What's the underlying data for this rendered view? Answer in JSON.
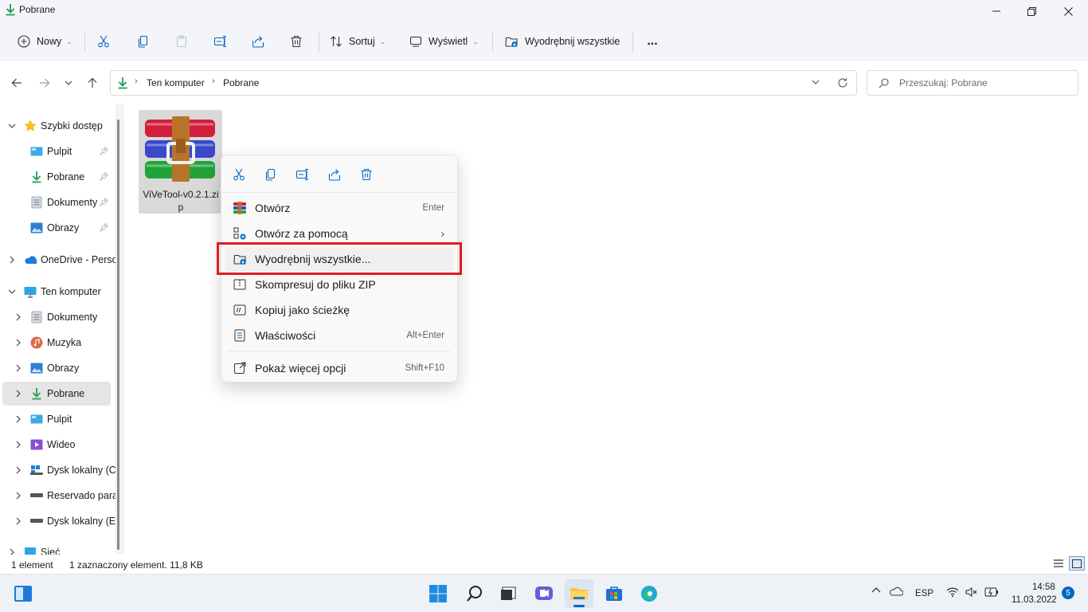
{
  "window": {
    "title": "Pobrane"
  },
  "toolbar": {
    "new_label": "Nowy",
    "sort_label": "Sortuj",
    "view_label": "Wyświetl",
    "extract_label": "Wyodrębnij wszystkie",
    "more_label": "..."
  },
  "address": {
    "crumbs": [
      "Ten komputer",
      "Pobrane"
    ],
    "search_placeholder": "Przeszukaj: Pobrane"
  },
  "sidebar": {
    "quick_access": "Szybki dostęp",
    "quick_items": [
      "Pulpit",
      "Pobrane",
      "Dokumenty",
      "Obrazy"
    ],
    "onedrive": "OneDrive - Perso",
    "this_pc": "Ten komputer",
    "pc_items": [
      "Dokumenty",
      "Muzyka",
      "Obrazy",
      "Pobrane",
      "Pulpit",
      "Wideo",
      "Dysk lokalny (C",
      "Reservado para",
      "Dysk lokalny (E"
    ],
    "network": "Sieć"
  },
  "file": {
    "name": "ViVeTool-v0.2.1.zip"
  },
  "context_menu": {
    "items": [
      {
        "label": "Otwórz",
        "shortcut": "Enter"
      },
      {
        "label": "Otwórz za pomocą",
        "shortcut": ""
      },
      {
        "label": "Wyodrębnij wszystkie...",
        "shortcut": ""
      },
      {
        "label": "Skompresuj do pliku ZIP",
        "shortcut": ""
      },
      {
        "label": "Kopiuj jako ścieżkę",
        "shortcut": ""
      },
      {
        "label": "Właściwości",
        "shortcut": "Alt+Enter"
      },
      {
        "label": "Pokaż więcej opcji",
        "shortcut": "Shift+F10"
      }
    ]
  },
  "status": {
    "count": "1 element",
    "selection": "1 zaznaczony element. 11,8 KB"
  },
  "taskbar": {
    "lang": "ESP",
    "time": "14:58",
    "date": "11.03.2022",
    "badge": "5"
  },
  "colors": {
    "accent": "#0067c0",
    "highlight": "#e01b24",
    "download_green": "#1f9e55"
  }
}
